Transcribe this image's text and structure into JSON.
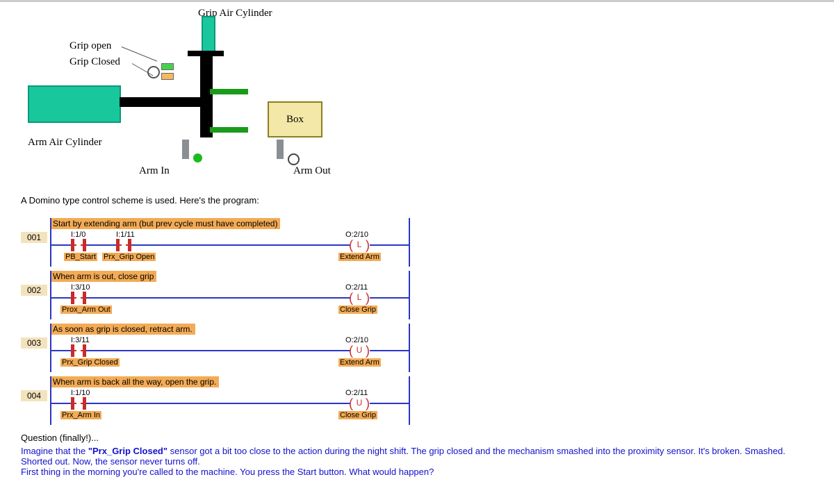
{
  "diagram": {
    "labels": {
      "grip_cyl": "Grip Air Cylinder",
      "grip_open": "Grip open",
      "grip_closed": "Grip Closed",
      "arm_cyl": "Arm Air Cylinder",
      "arm_in": "Arm In",
      "arm_out": "Arm Out",
      "box": "Box"
    },
    "sensors": {
      "grip_open": {
        "type": "prox",
        "state": "on"
      },
      "grip_closed": {
        "type": "prox",
        "state": "off"
      },
      "arm_in": {
        "type": "prox",
        "state": "on"
      },
      "arm_out": {
        "type": "prox",
        "state": "off"
      }
    },
    "icons": {
      "grip_open_sensor": "sensor-on-icon",
      "grip_closed_sensor": "sensor-off-icon",
      "arm_in_sensor": "prox-on-icon",
      "arm_out_sensor": "prox-off-icon"
    }
  },
  "intro": "A Domino type control scheme is used.  Here's the program:",
  "ladder": {
    "rungs": [
      {
        "num": "001",
        "comment": "Start by extending arm (but prev cycle must have completed)",
        "inputs": [
          {
            "addr": "I:1/0",
            "name": "PB_Start"
          },
          {
            "addr": "I:1/11",
            "name": "Prx_Grip Open"
          }
        ],
        "output": {
          "addr": "O:2/10",
          "type": "L",
          "name": "Extend Arm"
        }
      },
      {
        "num": "002",
        "comment": "When arm is out, close grip",
        "inputs": [
          {
            "addr": "I:3/10",
            "name": "Prox_Arm Out"
          }
        ],
        "output": {
          "addr": "O:2/11",
          "type": "L",
          "name": "Close Grip"
        }
      },
      {
        "num": "003",
        "comment": "As soon as grip is closed, retract arm.",
        "inputs": [
          {
            "addr": "I:3/11",
            "name": "Prx_Grip Closed"
          }
        ],
        "output": {
          "addr": "O:2/10",
          "type": "U",
          "name": "Extend Arm"
        }
      },
      {
        "num": "004",
        "comment": "When arm is back all the way, open the grip.",
        "inputs": [
          {
            "addr": "I:1/10",
            "name": "Prx_Arm In"
          }
        ],
        "output": {
          "addr": "O:2/11",
          "type": "U",
          "name": "Close Grip"
        }
      }
    ]
  },
  "question": {
    "title": "Question (finally!)...",
    "line1a": "Imagine that the ",
    "line1b": "\"Prx_Grip Closed\"",
    "line1c": " sensor got a bit too close to the action during the night shift.  The grip closed and the mechanism smashed into the proximity sensor. It's broken.  Smashed.  Shorted out.  Now, the sensor never turns off.",
    "line2": "First thing in the morning you're called to the machine.  You press the Start button.  What would happen?"
  }
}
